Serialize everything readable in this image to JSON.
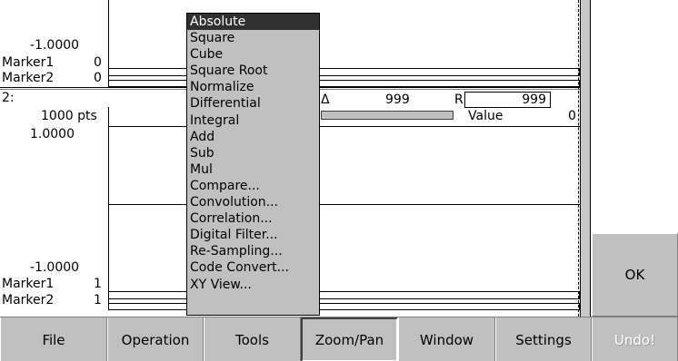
{
  "pane1": {
    "bottom_value": "-1.0000",
    "marker1_label": "Marker1",
    "marker1_value": "0",
    "marker2_label": "Marker2",
    "marker2_value": "0"
  },
  "pane2": {
    "index": "2:",
    "points": "1000 pts",
    "top_value": "1.0000",
    "bottom_value": "-1.0000",
    "marker1_label": "Marker1",
    "marker1_value": "1",
    "marker2_label": "Marker2",
    "marker2_value": "1",
    "delta_symbol": "Δ",
    "delta_value": "999",
    "r_label": "R",
    "r_value": "999",
    "value_label": "Value",
    "value_value": "0"
  },
  "menu": {
    "items": [
      "Absolute",
      "Square",
      "Cube",
      "Square Root",
      "Normalize",
      "Differential",
      "Integral",
      "Add",
      "Sub",
      "Mul",
      "Compare...",
      "Convolution...",
      "Correlation...",
      "Digital Filter...",
      "Re-Sampling...",
      "Code Convert...",
      "XY View..."
    ],
    "selected_index": 0
  },
  "ok_button": "OK",
  "toolbar": {
    "file": "File",
    "operation": "Operation",
    "tools": "Tools",
    "zoom_pan": "Zoom/Pan",
    "window": "Window",
    "settings": "Settings",
    "undo": "Undo!"
  },
  "colors": {
    "menu_bg": "#c0c0c0",
    "menu_selected_bg": "#303030",
    "toolbar_bg": "#c0c0c0"
  }
}
